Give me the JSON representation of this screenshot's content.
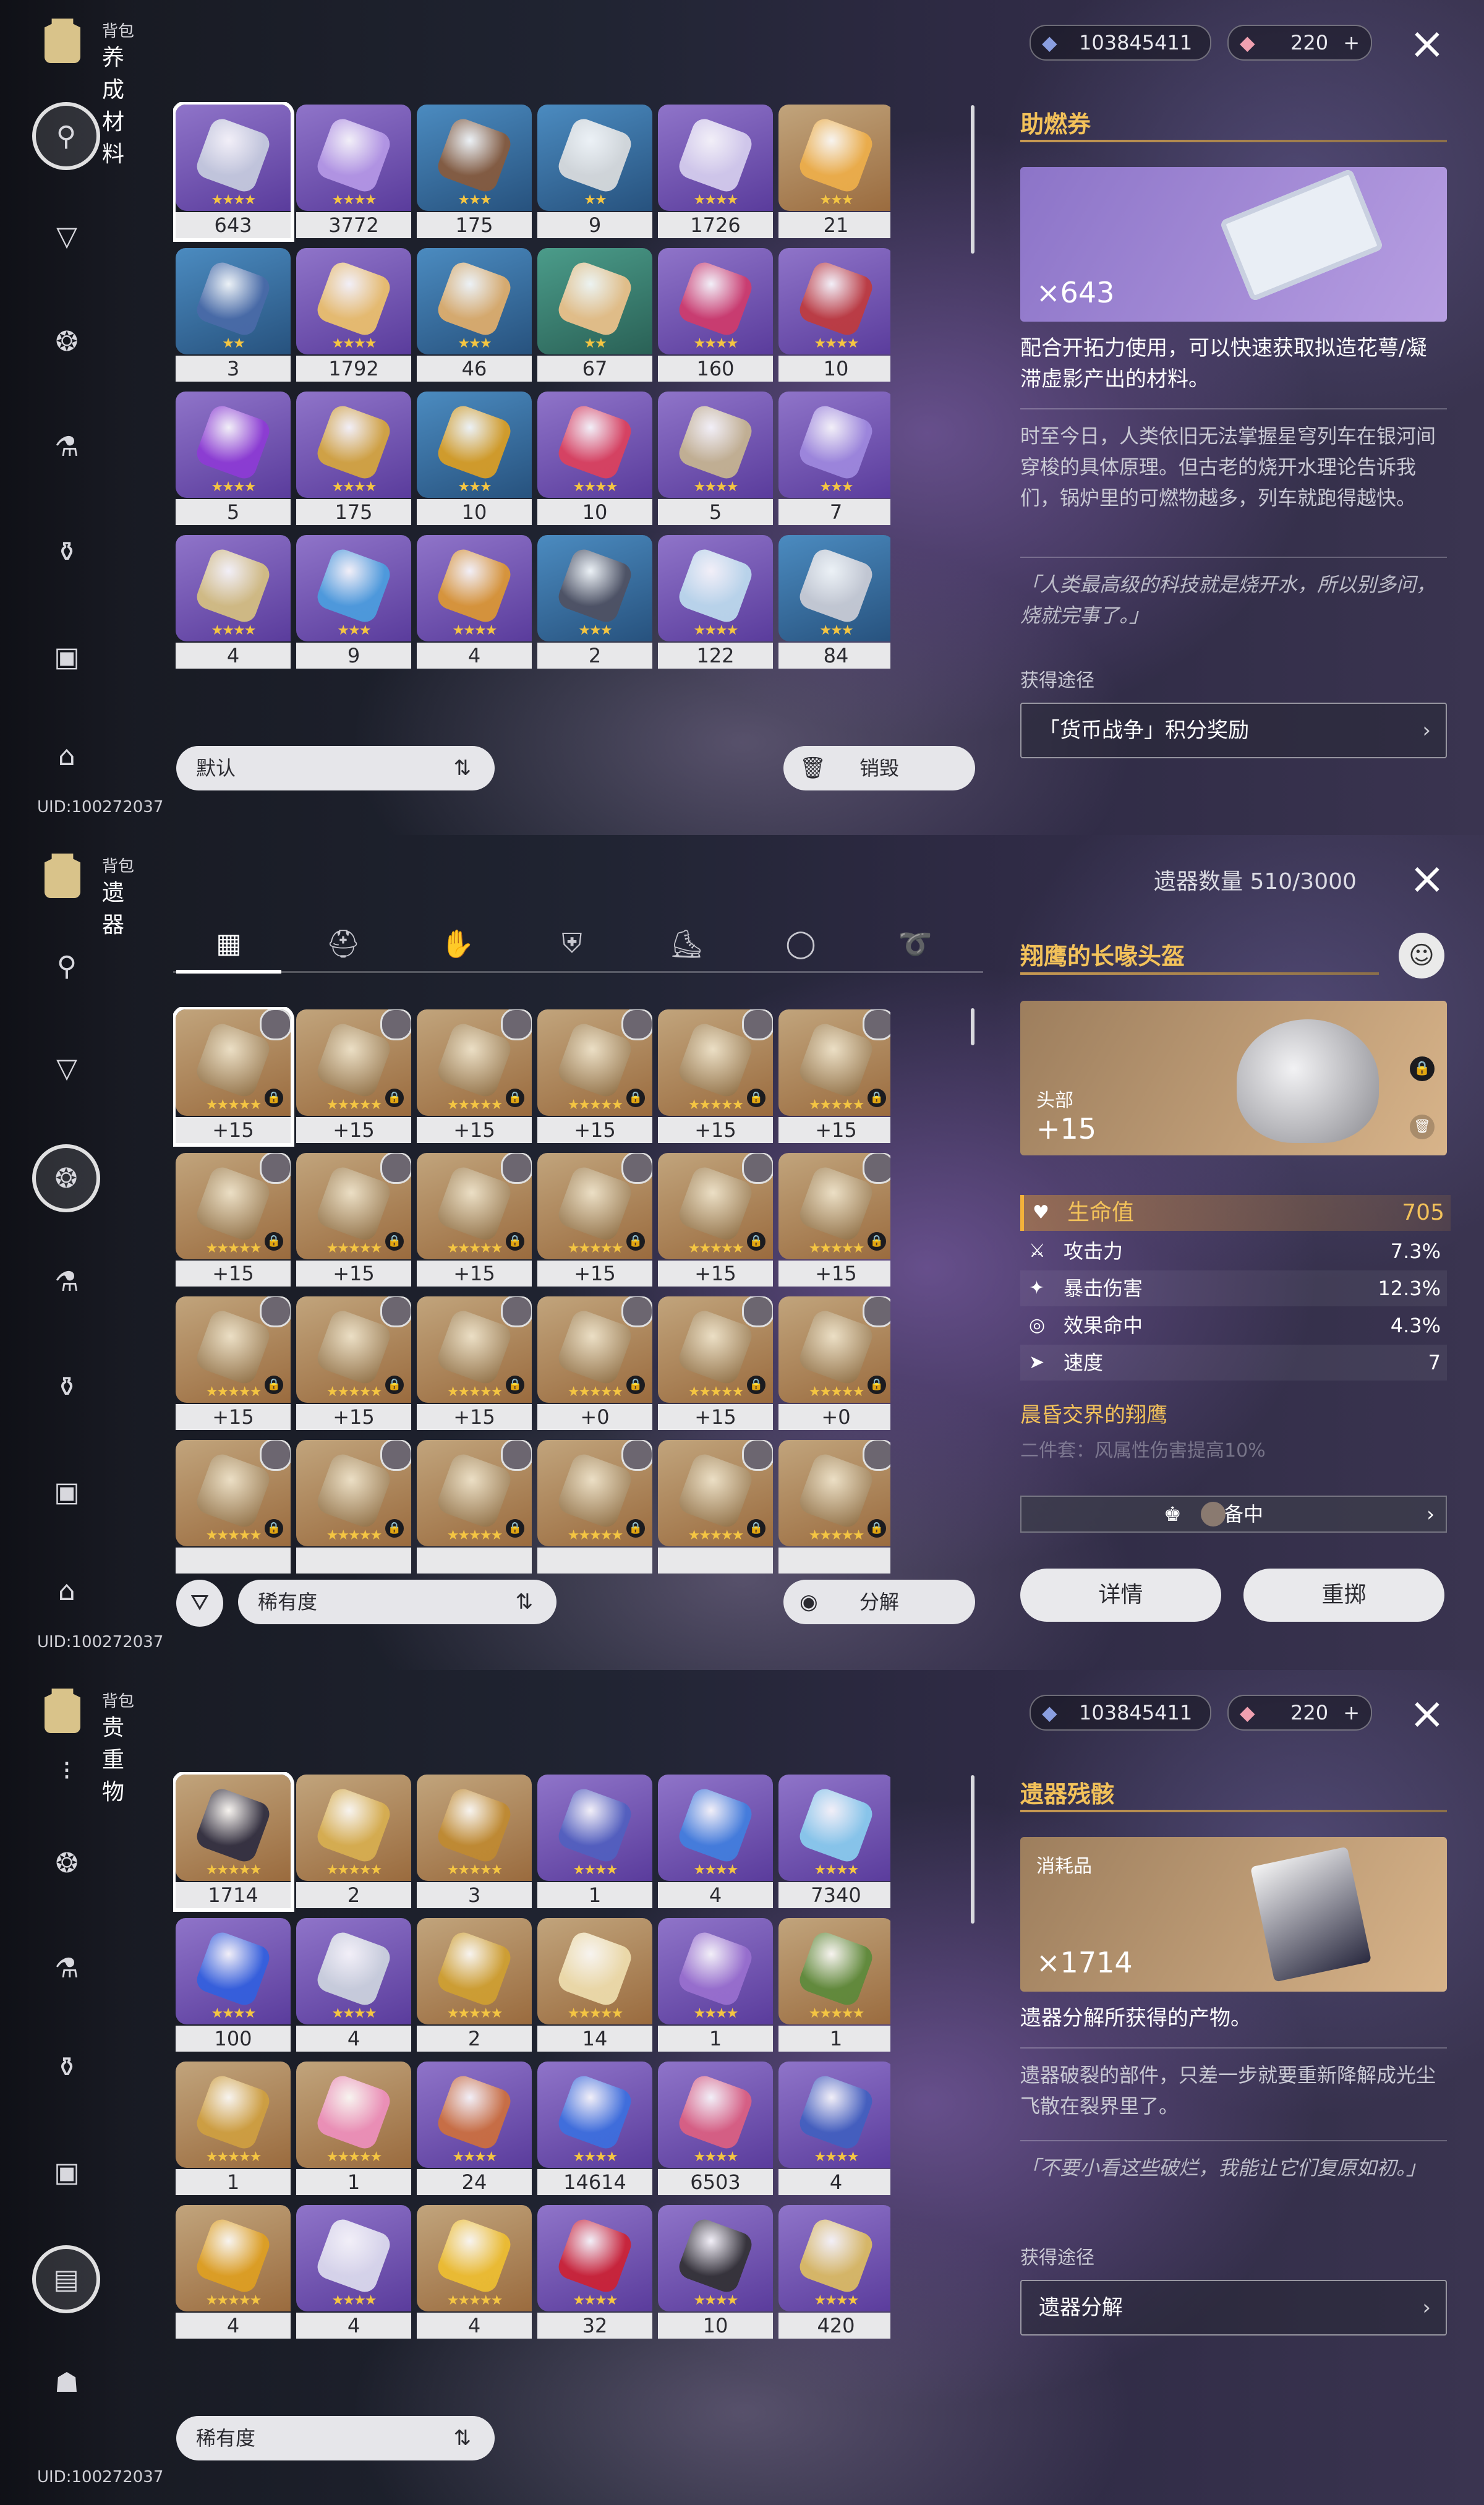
{
  "uid": "UID:100272037",
  "panel1": {
    "bag_label": "背包",
    "section_title": "养成材料",
    "currency": [
      {
        "value": "103845411",
        "icon": "star-pass-icon"
      },
      {
        "value": "220",
        "icon": "crystal-icon",
        "plus": "+"
      }
    ],
    "items": [
      {
        "count": "643",
        "rarity": 4,
        "stars": "★★★★",
        "color": "#c9d0e0"
      },
      {
        "count": "3772",
        "rarity": 4,
        "stars": "★★★★",
        "color": "#b79ae8"
      },
      {
        "count": "175",
        "rarity": 3,
        "stars": "★★★",
        "color": "#8a5a3a"
      },
      {
        "count": "9",
        "rarity": 3,
        "stars": "★★",
        "color": "#e0e0e0"
      },
      {
        "count": "1726",
        "rarity": 4,
        "stars": "★★★★",
        "color": "#d9d2f0"
      },
      {
        "count": "21",
        "rarity": 5,
        "stars": "★★★",
        "color": "#f0b04a"
      },
      {
        "count": "3",
        "rarity": 3,
        "stars": "★★",
        "color": "#4a6aa8"
      },
      {
        "count": "1792",
        "rarity": 4,
        "stars": "★★★★",
        "color": "#f1c56a"
      },
      {
        "count": "46",
        "rarity": 3,
        "stars": "★★★",
        "color": "#e6b06a"
      },
      {
        "count": "67",
        "rarity": 2,
        "stars": "★★",
        "color": "#f2c48c"
      },
      {
        "count": "160",
        "rarity": 4,
        "stars": "★★★★",
        "color": "#d23a6a"
      },
      {
        "count": "10",
        "rarity": 4,
        "stars": "★★★★",
        "color": "#c23a3a"
      },
      {
        "count": "5",
        "rarity": 4,
        "stars": "★★★★",
        "color": "#8e3ad6"
      },
      {
        "count": "175",
        "rarity": 4,
        "stars": "★★★★",
        "color": "#d9a93a"
      },
      {
        "count": "10",
        "rarity": 3,
        "stars": "★★★",
        "color": "#e0a020"
      },
      {
        "count": "10",
        "rarity": 4,
        "stars": "★★★★",
        "color": "#e0405a"
      },
      {
        "count": "5",
        "rarity": 4,
        "stars": "★★★★",
        "color": "#c9b890"
      },
      {
        "count": "7",
        "rarity": 4,
        "stars": "★★★",
        "color": "#a08ae0"
      },
      {
        "count": "4",
        "rarity": 4,
        "stars": "★★★★",
        "color": "#d9c480"
      },
      {
        "count": "9",
        "rarity": 4,
        "stars": "★★★",
        "color": "#4aa0e0"
      },
      {
        "count": "4",
        "rarity": 4,
        "stars": "★★★★",
        "color": "#e09a30"
      },
      {
        "count": "2",
        "rarity": 3,
        "stars": "★★★",
        "color": "#505060"
      },
      {
        "count": "122",
        "rarity": 4,
        "stars": "★★★★",
        "color": "#c0e0f0"
      },
      {
        "count": "84",
        "rarity": 3,
        "stars": "★★★",
        "color": "#d0d0d8"
      }
    ],
    "sort_label": "默认",
    "destroy_label": "销毁",
    "detail": {
      "title": "助燃券",
      "count": "643",
      "count_prefix": "×",
      "desc": "配合开拓力使用，可以快速获取拟造花萼/凝滞虚影产出的材料。",
      "lore": "时至今日，人类依旧无法掌握星穹列车在银河间穿梭的具体原理。但古老的烧开水理论告诉我们，锅炉里的可燃物越多，列车就跑得越快。",
      "quote": "「人类最高级的科技就是烧开水，所以别多问，烧就完事了。」",
      "source_label": "获得途径",
      "source": "「货币战争」积分奖励"
    }
  },
  "panel2": {
    "bag_label": "背包",
    "section_title": "遗器",
    "relic_count": "遗器数量 510/3000",
    "tabs": [
      "all",
      "head",
      "hands",
      "body",
      "feet",
      "sphere",
      "rope"
    ],
    "items": [
      {
        "level": "+15",
        "rarity": 5,
        "locked": true
      },
      {
        "level": "+15",
        "rarity": 5,
        "locked": true
      },
      {
        "level": "+15",
        "rarity": 5,
        "locked": true
      },
      {
        "level": "+15",
        "rarity": 5,
        "locked": true
      },
      {
        "level": "+15",
        "rarity": 5,
        "locked": true
      },
      {
        "level": "+15",
        "rarity": 5,
        "locked": true
      },
      {
        "level": "+15",
        "rarity": 5,
        "locked": true
      },
      {
        "level": "+15",
        "rarity": 5,
        "locked": true
      },
      {
        "level": "+15",
        "rarity": 5,
        "locked": true
      },
      {
        "level": "+15",
        "rarity": 5,
        "locked": true
      },
      {
        "level": "+15",
        "rarity": 5,
        "locked": true
      },
      {
        "level": "+15",
        "rarity": 5,
        "locked": true
      },
      {
        "level": "+15",
        "rarity": 5,
        "locked": true
      },
      {
        "level": "+15",
        "rarity": 5,
        "locked": true
      },
      {
        "level": "+15",
        "rarity": 5,
        "locked": true
      },
      {
        "level": "+0",
        "rarity": 5,
        "locked": true
      },
      {
        "level": "+15",
        "rarity": 5,
        "locked": true
      },
      {
        "level": "+0",
        "rarity": 5,
        "locked": true
      },
      {
        "level": "",
        "rarity": 5,
        "locked": true
      },
      {
        "level": "",
        "rarity": 5,
        "locked": true
      },
      {
        "level": "",
        "rarity": 5,
        "locked": true
      },
      {
        "level": "",
        "rarity": 5,
        "locked": true
      },
      {
        "level": "",
        "rarity": 5,
        "locked": true
      },
      {
        "level": "",
        "rarity": 5,
        "locked": true
      }
    ],
    "sort_label": "稀有度",
    "salvage_label": "分解",
    "detail": {
      "title": "翔鹰的长喙头盔",
      "slot": "头部",
      "level": "+15",
      "main_stat": {
        "name": "生命值",
        "value": "705"
      },
      "sub_stats": [
        {
          "name": "攻击力",
          "value": "7.3%",
          "icon": "attack-icon"
        },
        {
          "name": "暴击伤害",
          "value": "12.3%",
          "icon": "crit-damage-icon"
        },
        {
          "name": "效果命中",
          "value": "4.3%",
          "icon": "effect-hit-icon"
        },
        {
          "name": "速度",
          "value": "7",
          "icon": "speed-icon"
        }
      ],
      "set_name": "晨昏交界的翔鹰",
      "set_desc_faded": "二件套：风属性伤害提高10%",
      "equipped_label": "装备中",
      "details_btn": "详情",
      "reroll_btn": "重掷"
    }
  },
  "panel3": {
    "bag_label": "背包",
    "section_title": "贵重物",
    "currency": [
      {
        "value": "103845411",
        "icon": "star-pass-icon"
      },
      {
        "value": "220",
        "icon": "crystal-icon",
        "plus": "+"
      }
    ],
    "items": [
      {
        "count": "1714",
        "rarity": 5,
        "stars": "★★★★★",
        "color": "#2a2a40"
      },
      {
        "count": "2",
        "rarity": 5,
        "stars": "★★★★★",
        "color": "#d9b050"
      },
      {
        "count": "3",
        "rarity": 5,
        "stars": "★★★★★",
        "color": "#c08a30"
      },
      {
        "count": "1",
        "rarity": 4,
        "stars": "★★★★",
        "color": "#5060c0"
      },
      {
        "count": "4",
        "rarity": 4,
        "stars": "★★★★",
        "color": "#4080e0"
      },
      {
        "count": "7340",
        "rarity": 4,
        "stars": "★★★★",
        "color": "#8ad0f0"
      },
      {
        "count": "100",
        "rarity": 4,
        "stars": "★★★★",
        "color": "#3060e0"
      },
      {
        "count": "4",
        "rarity": 4,
        "stars": "★★★★",
        "color": "#d0d8e0"
      },
      {
        "count": "2",
        "rarity": 5,
        "stars": "★★★★★",
        "color": "#d0a030"
      },
      {
        "count": "14",
        "rarity": 5,
        "stars": "★★★★★",
        "color": "#f0e0b0"
      },
      {
        "count": "1",
        "rarity": 4,
        "stars": "★★★★",
        "color": "#9a70d0"
      },
      {
        "count": "1",
        "rarity": 5,
        "stars": "★★★★★",
        "color": "#5a8a3a"
      },
      {
        "count": "1",
        "rarity": 5,
        "stars": "★★★★★",
        "color": "#d0a040"
      },
      {
        "count": "1",
        "rarity": 5,
        "stars": "★★★★★",
        "color": "#f090c0"
      },
      {
        "count": "24",
        "rarity": 4,
        "stars": "★★★★",
        "color": "#d0703a"
      },
      {
        "count": "14614",
        "rarity": 4,
        "stars": "★★★★",
        "color": "#3a70e0"
      },
      {
        "count": "6503",
        "rarity": 4,
        "stars": "★★★★",
        "color": "#e06080"
      },
      {
        "count": "4",
        "rarity": 4,
        "stars": "★★★★",
        "color": "#4060c0"
      },
      {
        "count": "4",
        "rarity": 5,
        "stars": "★★★★★",
        "color": "#e0a020"
      },
      {
        "count": "4",
        "rarity": 4,
        "stars": "★★★★",
        "color": "#e0e0f0"
      },
      {
        "count": "4",
        "rarity": 5,
        "stars": "★★★★★",
        "color": "#f0c030"
      },
      {
        "count": "32",
        "rarity": 4,
        "stars": "★★★★",
        "color": "#d02030"
      },
      {
        "count": "10",
        "rarity": 4,
        "stars": "★★★★",
        "color": "#303030"
      },
      {
        "count": "420",
        "rarity": 4,
        "stars": "★★★★",
        "color": "#e0c060"
      }
    ],
    "sort_label": "稀有度",
    "detail": {
      "title": "遗器残骸",
      "category": "消耗品",
      "count": "1714",
      "count_prefix": "×",
      "desc": "遗器分解所获得的产物。",
      "lore": "遗器破裂的部件，只差一步就要重新降解成光尘飞散在裂界里了。",
      "quote": "「不要小看这些破烂，我能让它们复原如初。」",
      "source_label": "获得途径",
      "source": "遗器分解"
    }
  },
  "close_icon": "×",
  "chevron": "›"
}
